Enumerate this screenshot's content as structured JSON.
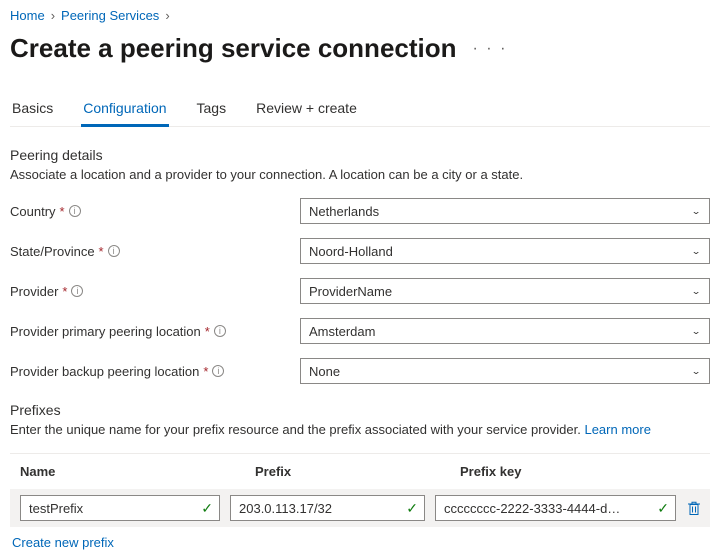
{
  "breadcrumb": {
    "home": "Home",
    "peering_services": "Peering Services"
  },
  "page_title": "Create a peering service connection",
  "tabs": {
    "basics": "Basics",
    "configuration": "Configuration",
    "tags": "Tags",
    "review": "Review + create"
  },
  "section": {
    "peering_details_title": "Peering details",
    "peering_details_sub": "Associate a location and a provider to your connection. A location can be a city or a state.",
    "prefixes_title": "Prefixes",
    "prefixes_sub": "Enter the unique name for your prefix resource and the prefix associated with your service provider. ",
    "learn_more": "Learn more"
  },
  "fields": {
    "country": {
      "label": "Country",
      "value": "Netherlands"
    },
    "state": {
      "label": "State/Province",
      "value": "Noord-Holland"
    },
    "provider": {
      "label": "Provider",
      "value": "ProviderName"
    },
    "primary": {
      "label": "Provider primary peering location",
      "value": "Amsterdam"
    },
    "backup": {
      "label": "Provider backup peering location",
      "value": "None"
    }
  },
  "grid": {
    "headers": {
      "name": "Name",
      "prefix": "Prefix",
      "key": "Prefix key"
    },
    "rows": [
      {
        "name": "testPrefix",
        "prefix": "203.0.113.17/32",
        "key": "cccccccc-2222-3333-4444-d…"
      }
    ],
    "create_new": "Create new prefix"
  },
  "glyphs": {
    "chevron_right": "›",
    "chevron_down": "⌄",
    "check": "✓",
    "info": "i",
    "dots": "· · ·"
  }
}
